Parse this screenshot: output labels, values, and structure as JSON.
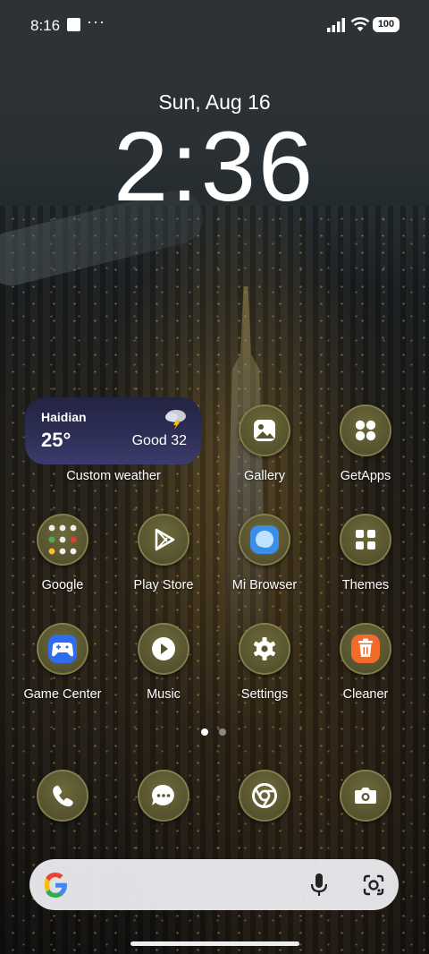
{
  "status_bar": {
    "time": "8:16",
    "dots": "···",
    "battery": "100"
  },
  "lockscreen": {
    "date": "Sun, Aug 16",
    "time": "2:36"
  },
  "weather_widget": {
    "city": "Haidian",
    "temperature": "25°",
    "air_quality": "Good 32",
    "label": "Custom weather",
    "icon": "thunderstorm-icon"
  },
  "apps": [
    {
      "label": "Gallery",
      "icon": "gallery-icon"
    },
    {
      "label": "GetApps",
      "icon": "getapps-icon"
    },
    {
      "label": "Google",
      "icon": "folder-icon"
    },
    {
      "label": "Play Store",
      "icon": "play-store-icon"
    },
    {
      "label": "Mi Browser",
      "icon": "mi-browser-icon"
    },
    {
      "label": "Themes",
      "icon": "themes-icon"
    },
    {
      "label": "Game Center",
      "icon": "game-center-icon"
    },
    {
      "label": "Music",
      "icon": "music-icon"
    },
    {
      "label": "Settings",
      "icon": "gear-icon"
    },
    {
      "label": "Cleaner",
      "icon": "cleaner-icon"
    }
  ],
  "dock": [
    {
      "icon": "phone-icon"
    },
    {
      "icon": "messages-icon"
    },
    {
      "icon": "chrome-icon"
    },
    {
      "icon": "camera-icon"
    }
  ],
  "page_indicator": {
    "pages": 2,
    "current": 1
  },
  "search_bar": {
    "icons": [
      "google-g-icon",
      "mic-icon",
      "lens-icon"
    ]
  },
  "colors": {
    "icon_bg": "#575430",
    "weather_bg": "#2d2e55",
    "cleaner_orange": "#f26b2a",
    "browser_blue": "#3a8ee8",
    "game_blue": "#2f6df0"
  }
}
